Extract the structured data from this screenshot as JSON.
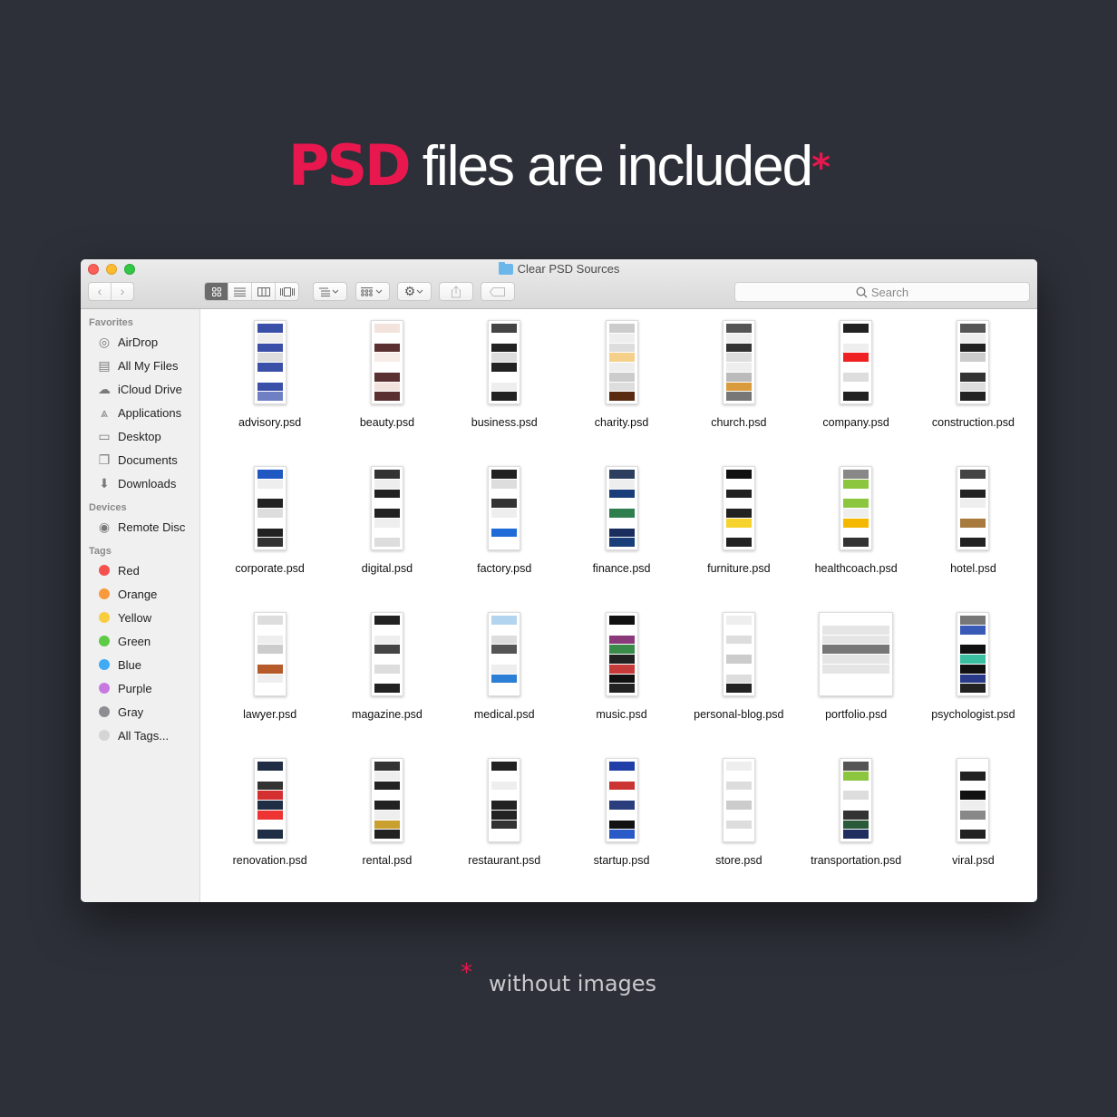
{
  "headline": {
    "accent": "PSD",
    "rest": " files are included",
    "mark": "*"
  },
  "window": {
    "title": "Clear PSD Sources",
    "toolbar": {
      "back": "‹",
      "forward": "›",
      "views": [
        "icon-view",
        "list-view",
        "column-view",
        "cover-flow-view"
      ],
      "search_placeholder": "Search"
    }
  },
  "sidebar": {
    "sections": [
      {
        "heading": "Favorites",
        "items": [
          {
            "label": "AirDrop",
            "icon": "airdrop-icon"
          },
          {
            "label": "All My Files",
            "icon": "all-files-icon"
          },
          {
            "label": "iCloud Drive",
            "icon": "cloud-icon"
          },
          {
            "label": "Applications",
            "icon": "applications-icon"
          },
          {
            "label": "Desktop",
            "icon": "desktop-icon"
          },
          {
            "label": "Documents",
            "icon": "documents-icon"
          },
          {
            "label": "Downloads",
            "icon": "downloads-icon"
          }
        ]
      },
      {
        "heading": "Devices",
        "items": [
          {
            "label": "Remote Disc",
            "icon": "disc-icon"
          }
        ]
      },
      {
        "heading": "Tags",
        "items": [
          {
            "label": "Red",
            "color": "#f5504e"
          },
          {
            "label": "Orange",
            "color": "#f89a3c"
          },
          {
            "label": "Yellow",
            "color": "#f8cd3e"
          },
          {
            "label": "Green",
            "color": "#5ccb45"
          },
          {
            "label": "Blue",
            "color": "#3fabf5"
          },
          {
            "label": "Purple",
            "color": "#c879e0"
          },
          {
            "label": "Gray",
            "color": "#8e8e92"
          },
          {
            "label": "All Tags...",
            "color": "#d5d5d5"
          }
        ]
      }
    ]
  },
  "files": [
    {
      "name": "advisory.psd",
      "palette": [
        "#3a4fa8",
        "#eee",
        "#3a4fa8",
        "#ddd",
        "#3a4fa8",
        "#fff",
        "#3a4fa8",
        "#6f7fc4"
      ]
    },
    {
      "name": "beauty.psd",
      "palette": [
        "#f3e3dd",
        "#fff",
        "#5b3030",
        "#f6ece8",
        "#fff",
        "#5b3030",
        "#f3e3dd",
        "#5b3030"
      ]
    },
    {
      "name": "business.psd",
      "palette": [
        "#444",
        "#fff",
        "#222",
        "#ddd",
        "#222",
        "#fff",
        "#eee",
        "#222"
      ]
    },
    {
      "name": "charity.psd",
      "palette": [
        "#ccc",
        "#eee",
        "#ddd",
        "#f4d08a",
        "#eee",
        "#ccc",
        "#ddd",
        "#5a2a10"
      ]
    },
    {
      "name": "church.psd",
      "palette": [
        "#555",
        "#eee",
        "#333",
        "#ddd",
        "#eee",
        "#bbb",
        "#d99b3c",
        "#777"
      ]
    },
    {
      "name": "company.psd",
      "palette": [
        "#222",
        "#fff",
        "#eee",
        "#e22",
        "#fff",
        "#ddd",
        "#fff",
        "#222"
      ]
    },
    {
      "name": "construction.psd",
      "palette": [
        "#555",
        "#eee",
        "#222",
        "#ccc",
        "#fff",
        "#333",
        "#ddd",
        "#222"
      ]
    },
    {
      "name": "corporate.psd",
      "palette": [
        "#1f57c3",
        "#eee",
        "#fff",
        "#222",
        "#ddd",
        "#fff",
        "#222",
        "#333"
      ]
    },
    {
      "name": "digital.psd",
      "palette": [
        "#333",
        "#eee",
        "#222",
        "#fff",
        "#222",
        "#eee",
        "#fff",
        "#ddd"
      ]
    },
    {
      "name": "factory.psd",
      "palette": [
        "#222",
        "#ddd",
        "#fff",
        "#333",
        "#eee",
        "#fff",
        "#1f6bd8",
        "#fff"
      ]
    },
    {
      "name": "finance.psd",
      "palette": [
        "#2d3e5e",
        "#eee",
        "#1a3e7a",
        "#fff",
        "#2e7e4e",
        "#fff",
        "#1a2e5e",
        "#1a3e7a"
      ]
    },
    {
      "name": "furniture.psd",
      "palette": [
        "#111",
        "#fff",
        "#222",
        "#fff",
        "#222",
        "#f5d32c",
        "#fff",
        "#222"
      ]
    },
    {
      "name": "healthcoach.psd",
      "palette": [
        "#888",
        "#8cc63f",
        "#fff",
        "#8cc63f",
        "#eee",
        "#f5b800",
        "#fff",
        "#333"
      ]
    },
    {
      "name": "hotel.psd",
      "palette": [
        "#444",
        "#fff",
        "#222",
        "#eee",
        "#fff",
        "#a87a3e",
        "#fff",
        "#222"
      ]
    },
    {
      "name": "lawyer.psd",
      "palette": [
        "#ddd",
        "#fff",
        "#eee",
        "#ccc",
        "#fff",
        "#b65a2a",
        "#eee",
        "#fff"
      ]
    },
    {
      "name": "magazine.psd",
      "palette": [
        "#222",
        "#fff",
        "#eee",
        "#444",
        "#fff",
        "#ddd",
        "#fff",
        "#222"
      ]
    },
    {
      "name": "medical.psd",
      "palette": [
        "#b3d4ee",
        "#fff",
        "#ddd",
        "#555",
        "#fff",
        "#eee",
        "#2c7fd4",
        "#fff"
      ]
    },
    {
      "name": "music.psd",
      "palette": [
        "#111",
        "#fff",
        "#8a3a7a",
        "#3a8a4a",
        "#222",
        "#c63a3a",
        "#111",
        "#222"
      ]
    },
    {
      "name": "personal-blog.psd",
      "palette": [
        "#eee",
        "#fff",
        "#ddd",
        "#fff",
        "#ccc",
        "#fff",
        "#ddd",
        "#222"
      ]
    },
    {
      "name": "portfolio.psd",
      "palette": [
        "#fff",
        "#e5e5e5",
        "#e5e5e5",
        "#777",
        "#e5e5e5",
        "#e5e5e5",
        "#fff",
        "#fff"
      ],
      "wide": true
    },
    {
      "name": "psychologist.psd",
      "palette": [
        "#777",
        "#3a5ab8",
        "#fff",
        "#111",
        "#3ac0a0",
        "#111",
        "#2a3a8a",
        "#222"
      ]
    },
    {
      "name": "renovation.psd",
      "palette": [
        "#1f2e44",
        "#fff",
        "#333",
        "#d43030",
        "#1f2e44",
        "#e33",
        "#fff",
        "#1f2e44"
      ]
    },
    {
      "name": "rental.psd",
      "palette": [
        "#333",
        "#eee",
        "#222",
        "#fff",
        "#222",
        "#eee",
        "#c9a030",
        "#222"
      ]
    },
    {
      "name": "restaurant.psd",
      "palette": [
        "#222",
        "#fff",
        "#eee",
        "#fff",
        "#222",
        "#222",
        "#333",
        "#fff"
      ]
    },
    {
      "name": "startup.psd",
      "palette": [
        "#1f3ea8",
        "#fff",
        "#c33",
        "#fff",
        "#2a3e7e",
        "#fff",
        "#111",
        "#2a5ac8"
      ]
    },
    {
      "name": "store.psd",
      "palette": [
        "#eee",
        "#fff",
        "#ddd",
        "#fff",
        "#ccc",
        "#fff",
        "#ddd",
        "#fff"
      ]
    },
    {
      "name": "transportation.psd",
      "palette": [
        "#555",
        "#8cc63f",
        "#fff",
        "#ddd",
        "#fff",
        "#333",
        "#2a5a3a",
        "#1f2e5e"
      ]
    },
    {
      "name": "viral.psd",
      "palette": [
        "#fff",
        "#222",
        "#fff",
        "#111",
        "#eee",
        "#888",
        "#fff",
        "#222"
      ]
    }
  ],
  "footnote": {
    "mark": "*",
    "text": "without images"
  }
}
